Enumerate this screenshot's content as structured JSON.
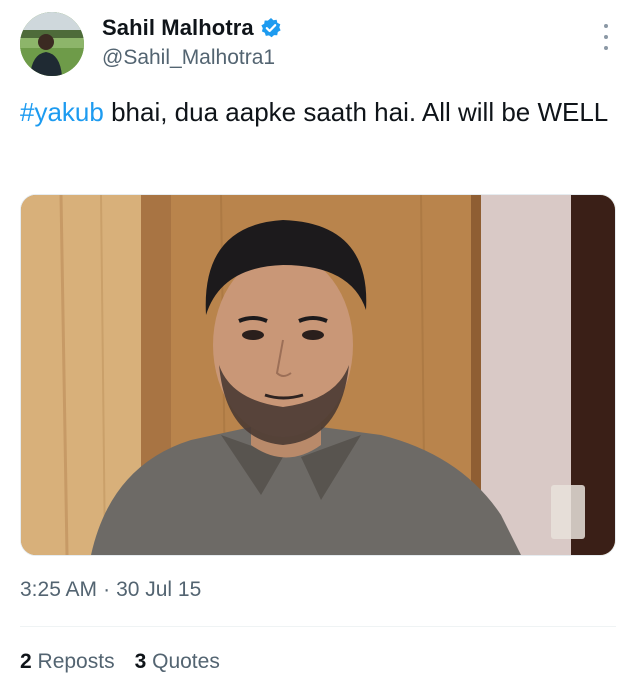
{
  "author": {
    "display_name": "Sahil Malhotra",
    "handle": "@Sahil_Malhotra1",
    "verified_icon": "verified-badge-icon",
    "verified_color": "#1d9bf0"
  },
  "tweet": {
    "hashtag": "#yakub",
    "text": " bhai, dua aapke saath hai. All will be WELL"
  },
  "meta": {
    "time": "3:25 AM",
    "separator": "·",
    "date": "30 Jul 15"
  },
  "stats": {
    "reposts_count": "2",
    "reposts_label": "Reposts",
    "quotes_count": "3",
    "quotes_label": "Quotes"
  },
  "colors": {
    "link": "#1d9bf0",
    "secondary_text": "#536471",
    "primary_text": "#0f1419"
  }
}
